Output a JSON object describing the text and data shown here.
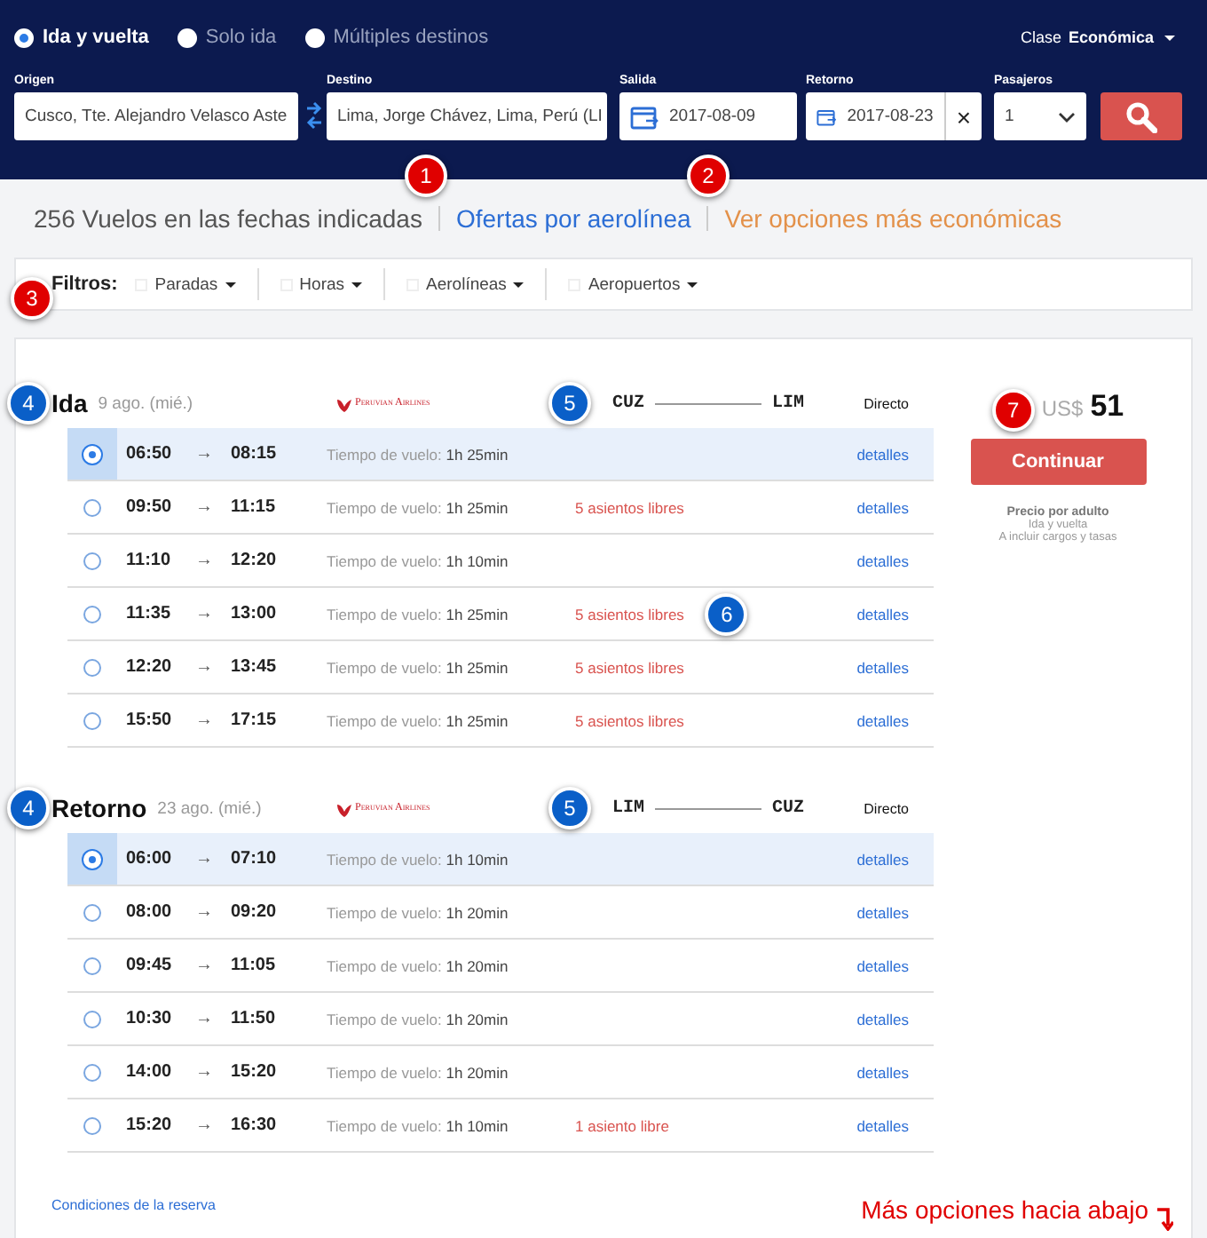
{
  "trip_types": [
    {
      "label": "Ida y vuelta",
      "selected": true
    },
    {
      "label": "Solo ida",
      "selected": false
    },
    {
      "label": "Múltiples destinos",
      "selected": false
    }
  ],
  "class_selector": {
    "label": "Clase",
    "value": "Económica"
  },
  "search": {
    "origin": {
      "label": "Origen",
      "value": "Cusco, Tte. Alejandro Velasco Aste"
    },
    "destination": {
      "label": "Destino",
      "value": "Lima, Jorge Chávez, Lima, Perú (LI"
    },
    "departure": {
      "label": "Salida",
      "value": "2017-08-09"
    },
    "return": {
      "label": "Retorno",
      "value": "2017-08-23",
      "clear": "×"
    },
    "passengers": {
      "label": "Pasajeros",
      "value": "1"
    }
  },
  "results_bar": {
    "count": "256 Vuelos en las fechas indicadas",
    "offers_link": "Ofertas por aerolínea",
    "offers_badge": {
      "number": "1",
      "color": "#e00000"
    },
    "cheaper_link": "Ver opciones más económicas",
    "cheaper_badge": {
      "number": "2",
      "color": "#e00000"
    }
  },
  "filters": {
    "label": "Filtros:",
    "badge": {
      "number": "3",
      "color": "#e00000"
    },
    "items": [
      "Paradas",
      "Horas",
      "Aerolíneas",
      "Aeropuertos"
    ]
  },
  "sections": [
    {
      "title": "Ida",
      "date": "9 ago. (mié.)",
      "badge": {
        "number": "4",
        "color": "#0a5fc8"
      },
      "airline": "Peruvian Airlines",
      "route_badge": {
        "number": "5",
        "color": "#0a5fc8"
      },
      "from": "CUZ",
      "to": "LIM",
      "stops": "Directo",
      "rows": [
        {
          "selected": true,
          "dep": "06:50",
          "arrow": "→",
          "arr": "08:15",
          "duration_label": "Tiempo de vuelo:",
          "duration": "1h 25min",
          "link": "detalles"
        },
        {
          "selected": false,
          "dep": "09:50",
          "arrow": "→",
          "arr": "11:15",
          "duration_label": "Tiempo de vuelo:",
          "duration": "1h 25min",
          "seats": "5 asientos libres",
          "link": "detalles"
        },
        {
          "selected": false,
          "dep": "11:10",
          "arrow": "→",
          "arr": "12:20",
          "duration_label": "Tiempo de vuelo:",
          "duration": "1h 10min",
          "link": "detalles"
        },
        {
          "selected": false,
          "dep": "11:35",
          "arrow": "→",
          "arr": "13:00",
          "duration_label": "Tiempo de vuelo:",
          "duration": "1h 25min",
          "seats": "5 asientos libres",
          "badge": {
            "number": "6",
            "color": "#0a5fc8"
          },
          "link": "detalles"
        },
        {
          "selected": false,
          "dep": "12:20",
          "arrow": "→",
          "arr": "13:45",
          "duration_label": "Tiempo de vuelo:",
          "duration": "1h 25min",
          "seats": "5 asientos libres",
          "link": "detalles"
        },
        {
          "selected": false,
          "dep": "15:50",
          "arrow": "→",
          "arr": "17:15",
          "duration_label": "Tiempo de vuelo:",
          "duration": "1h 25min",
          "seats": "5 asientos libres",
          "link": "detalles"
        }
      ]
    },
    {
      "title": "Retorno",
      "date": "23 ago. (mié.)",
      "badge": {
        "number": "4",
        "color": "#0a5fc8"
      },
      "airline": "Peruvian Airlines",
      "route_badge": {
        "number": "5",
        "color": "#0a5fc8"
      },
      "from": "LIM",
      "to": "CUZ",
      "stops": "Directo",
      "rows": [
        {
          "selected": true,
          "dep": "06:00",
          "arrow": "→",
          "arr": "07:10",
          "duration_label": "Tiempo de vuelo:",
          "duration": "1h 10min",
          "link": "detalles"
        },
        {
          "selected": false,
          "dep": "08:00",
          "arrow": "→",
          "arr": "09:20",
          "duration_label": "Tiempo de vuelo:",
          "duration": "1h 20min",
          "link": "detalles"
        },
        {
          "selected": false,
          "dep": "09:45",
          "arrow": "→",
          "arr": "11:05",
          "duration_label": "Tiempo de vuelo:",
          "duration": "1h 20min",
          "link": "detalles"
        },
        {
          "selected": false,
          "dep": "10:30",
          "arrow": "→",
          "arr": "11:50",
          "duration_label": "Tiempo de vuelo:",
          "duration": "1h 20min",
          "link": "detalles"
        },
        {
          "selected": false,
          "dep": "14:00",
          "arrow": "→",
          "arr": "15:20",
          "duration_label": "Tiempo de vuelo:",
          "duration": "1h 20min",
          "link": "detalles"
        },
        {
          "selected": false,
          "dep": "15:20",
          "arrow": "→",
          "arr": "16:30",
          "duration_label": "Tiempo de vuelo:",
          "duration": "1h 10min",
          "seats": "1 asiento libre",
          "link": "detalles"
        }
      ]
    }
  ],
  "price": {
    "badge": {
      "number": "7",
      "color": "#e00000"
    },
    "currency": "US$",
    "amount": "51",
    "button": "Continuar",
    "note_title": "Precio por adulto",
    "note_lines": [
      "Ida y vuelta",
      "A incluir cargos y tasas"
    ]
  },
  "conditions_link": "Condiciones de la reserva",
  "scroll_hint": "Más opciones hacia abajo"
}
